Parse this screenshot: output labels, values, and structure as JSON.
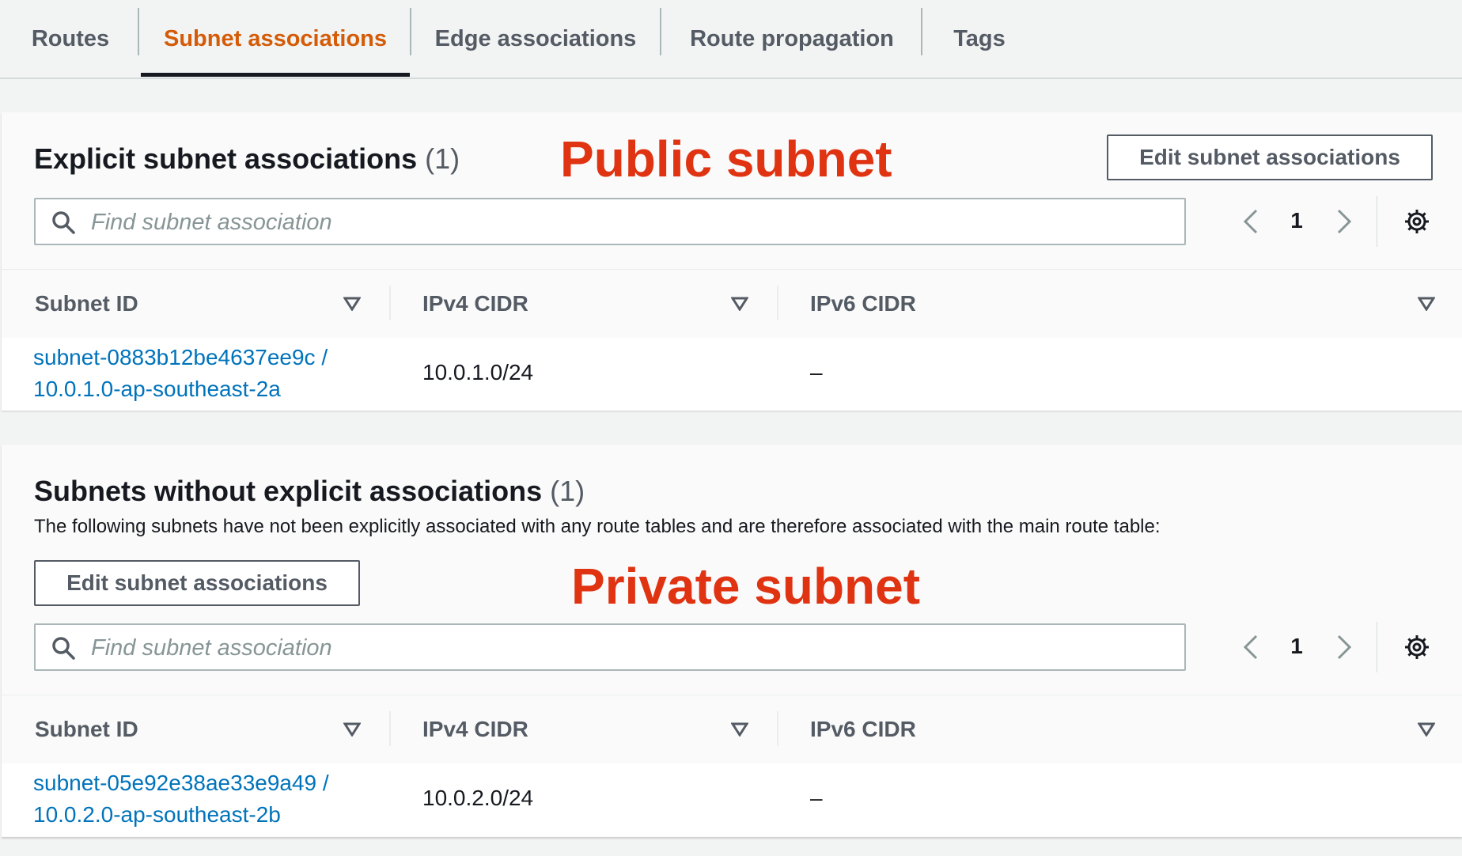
{
  "tabs": [
    {
      "label": "Routes",
      "active": false
    },
    {
      "label": "Subnet associations",
      "active": true
    },
    {
      "label": "Edge associations",
      "active": false
    },
    {
      "label": "Route propagation",
      "active": false
    },
    {
      "label": "Tags",
      "active": false
    }
  ],
  "colors": {
    "active_tab": "#d45b07",
    "annotation": "#df3312",
    "link": "#0073bb",
    "background": "#f2f3f3"
  },
  "explicit": {
    "title": "Explicit subnet associations",
    "count": "(1)",
    "annotation": "Public subnet",
    "edit_button": "Edit subnet associations",
    "search_placeholder": "Find subnet association",
    "page": "1",
    "columns": [
      "Subnet ID",
      "IPv4 CIDR",
      "IPv6 CIDR"
    ],
    "rows": [
      {
        "subnet_line1": "subnet-0883b12be4637ee9c /",
        "subnet_line2": "10.0.1.0-ap-southeast-2a",
        "ipv4": "10.0.1.0/24",
        "ipv6": "–"
      }
    ]
  },
  "implicit": {
    "title": "Subnets without explicit associations",
    "count": "(1)",
    "description": "The following subnets have not been explicitly associated with any route tables and are therefore associated with the main route table:",
    "annotation": "Private subnet",
    "edit_button": "Edit subnet associations",
    "search_placeholder": "Find subnet association",
    "page": "1",
    "columns": [
      "Subnet ID",
      "IPv4 CIDR",
      "IPv6 CIDR"
    ],
    "rows": [
      {
        "subnet_line1": "subnet-05e92e38ae33e9a49 /",
        "subnet_line2": "10.0.2.0-ap-southeast-2b",
        "ipv4": "10.0.2.0/24",
        "ipv6": "–"
      }
    ]
  }
}
